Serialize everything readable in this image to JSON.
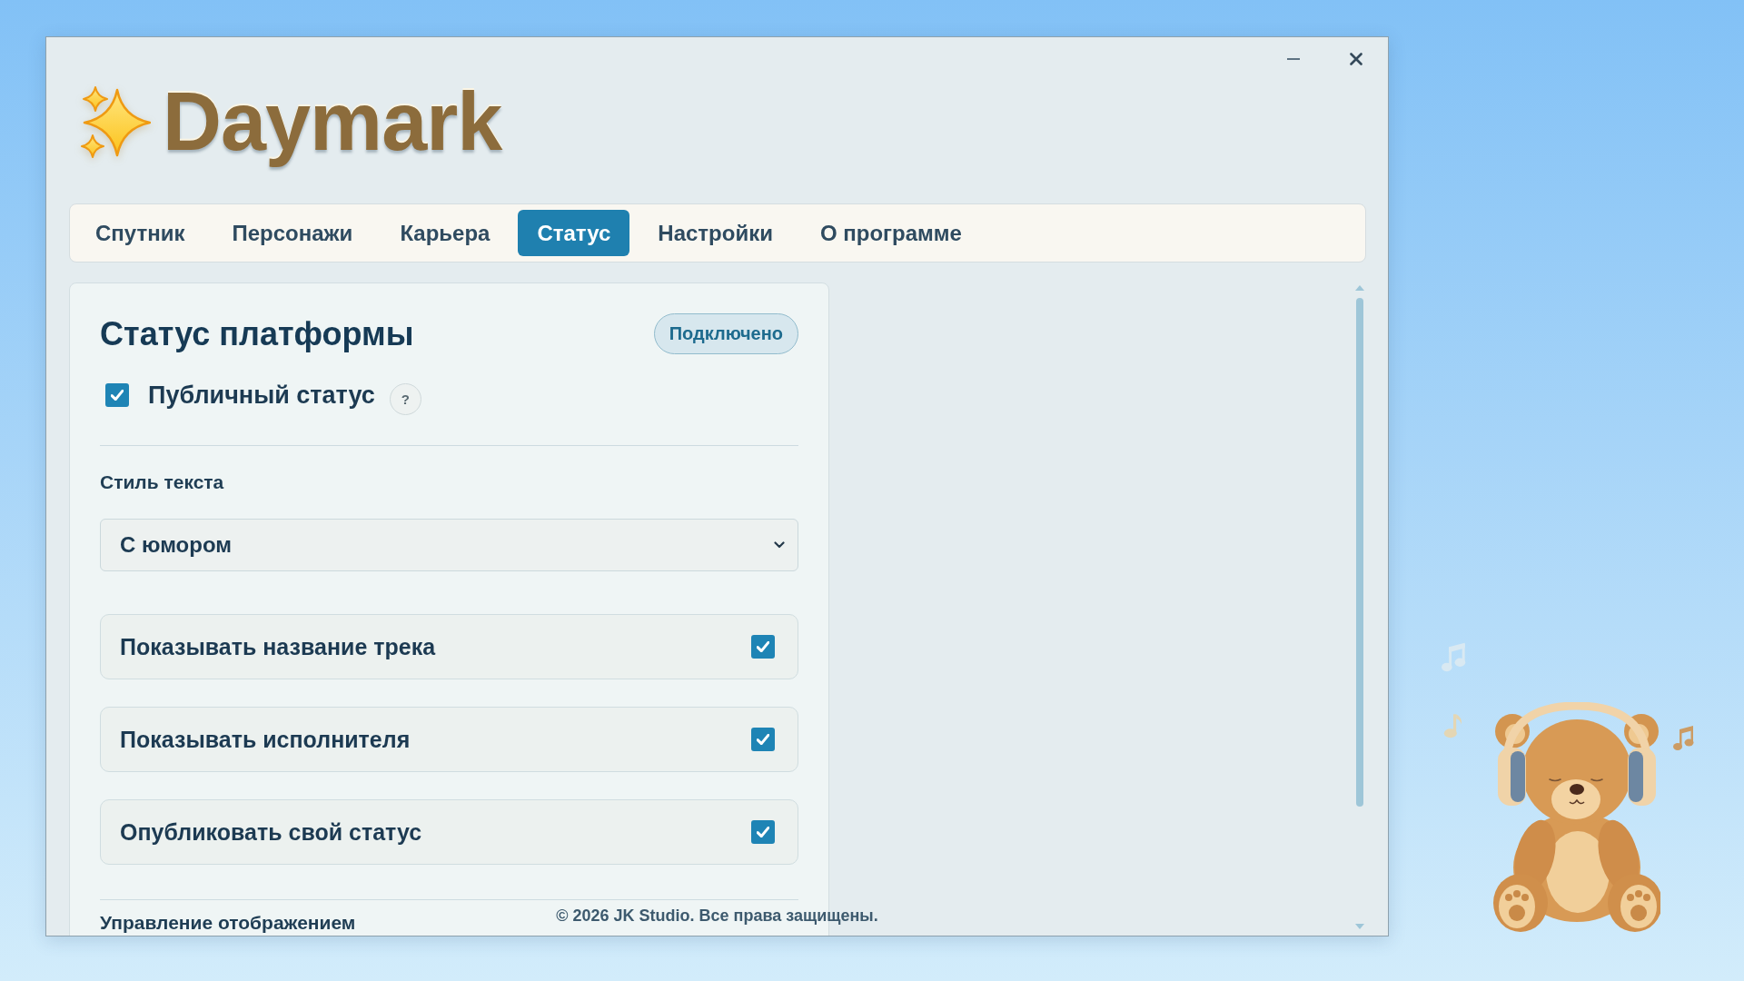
{
  "window": {
    "logo_text": "Daymark"
  },
  "tabs": [
    {
      "label": "Спутник",
      "selected": false
    },
    {
      "label": "Персонажи",
      "selected": false
    },
    {
      "label": "Карьера",
      "selected": false
    },
    {
      "label": "Статус",
      "selected": true
    },
    {
      "label": "Настройки",
      "selected": false
    },
    {
      "label": "О программе",
      "selected": false
    }
  ],
  "status_panel": {
    "title": "Статус платформы",
    "badge": "Подключено",
    "public_status": {
      "label": "Публичный статус",
      "checked": true,
      "help": "?"
    },
    "text_style": {
      "label": "Стиль текста",
      "value": "С юмором"
    },
    "options": [
      {
        "label": "Показывать название трека",
        "checked": true
      },
      {
        "label": "Показывать исполнителя",
        "checked": true
      },
      {
        "label": "Опубликовать свой статус",
        "checked": true
      }
    ],
    "next_section": "Управление отображением"
  },
  "footer": "© 2026 JK Studio. Все права защищены."
}
